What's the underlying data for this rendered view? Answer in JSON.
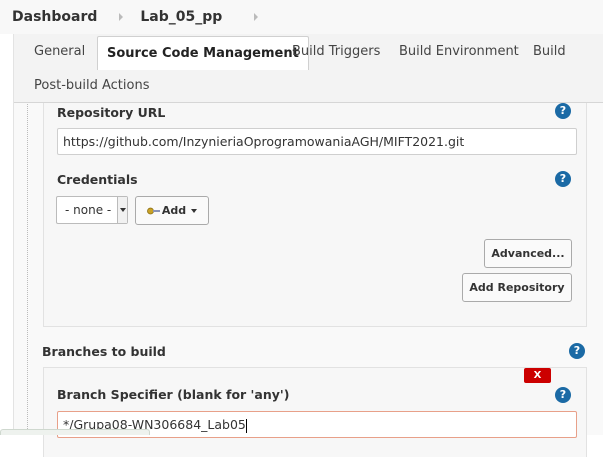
{
  "breadcrumb": {
    "dashboard": "Dashboard",
    "job": "Lab_05_pp"
  },
  "tabs": [
    {
      "label": "General"
    },
    {
      "label": "Source Code Management"
    },
    {
      "label": "Build Triggers"
    },
    {
      "label": "Build Environment"
    },
    {
      "label": "Build"
    },
    {
      "label": "Post-build Actions"
    }
  ],
  "active_tab": "Source Code Management",
  "scm": {
    "repository_url_label": "Repository URL",
    "repository_url_value": "https://github.com/InzynieriaOprogramowaniaAGH/MIFT2021.git",
    "credentials_label": "Credentials",
    "credentials_selected": "- none -",
    "add_label": "Add",
    "advanced_label": "Advanced...",
    "add_repository_label": "Add Repository",
    "help_glyph": "?"
  },
  "branches": {
    "section_label": "Branches to build",
    "branch_specifier_label": "Branch Specifier (blank for 'any')",
    "branch_specifier_value": "*/Grupa08-WN306684_Lab05",
    "delete_label": "X"
  },
  "colors": {
    "help_icon": "#1b6aa5",
    "delete_button": "#cc0000",
    "error_border": "#e8a089"
  }
}
